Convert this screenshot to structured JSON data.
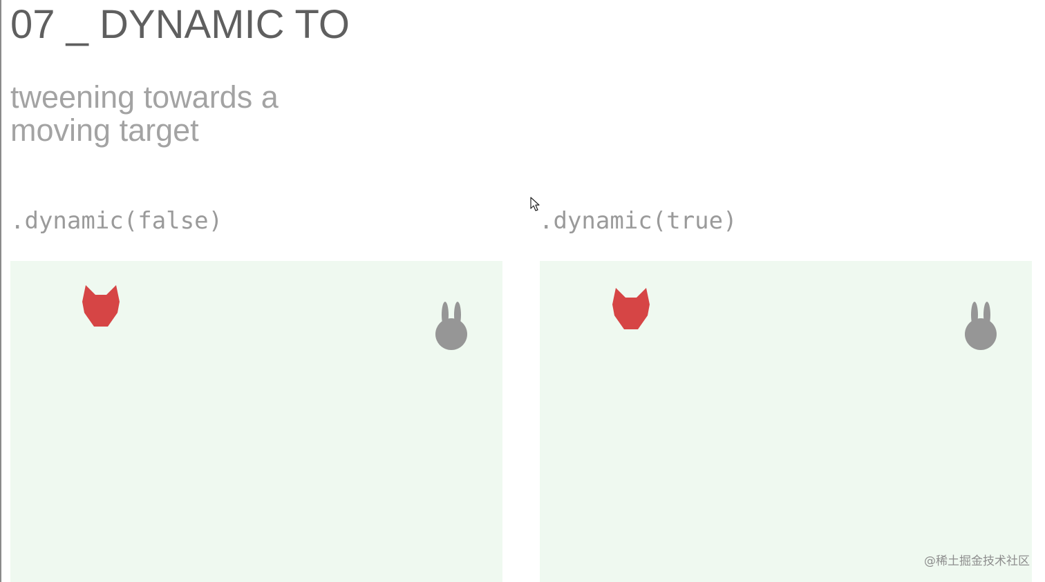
{
  "slide": {
    "title": "07 _ DYNAMIC TO",
    "subtitle_lines": [
      "tweening towards a",
      "moving target"
    ]
  },
  "demos": [
    {
      "label": ".dynamic(false)",
      "chaser": {
        "icon": "fox-icon",
        "color": "#d64545"
      },
      "target": {
        "icon": "rabbit-icon",
        "color": "#969696"
      }
    },
    {
      "label": ".dynamic(true)",
      "chaser": {
        "icon": "fox-icon",
        "color": "#d64545"
      },
      "target": {
        "icon": "rabbit-icon",
        "color": "#969696"
      }
    }
  ],
  "colors": {
    "stage_background": "#eff9f0",
    "title": "#5f5f5f",
    "subtitle": "#a3a3a3",
    "label": "#9a9a9a"
  },
  "cursor": {
    "icon": "mouse-pointer-icon"
  },
  "watermark": "@稀土掘金技术社区"
}
